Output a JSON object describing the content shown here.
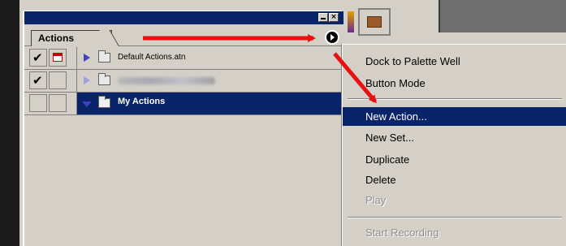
{
  "palette": {
    "tab_label": "Actions",
    "menu_button_icon": "play-triangle-icon",
    "sets": [
      {
        "name": "Default Actions.atn",
        "checked": true,
        "dialog": true,
        "expanded": false,
        "selected": false
      },
      {
        "name": "",
        "checked": true,
        "dialog": false,
        "expanded": false,
        "selected": false
      },
      {
        "name": "My Actions",
        "checked": false,
        "dialog": false,
        "expanded": true,
        "selected": true
      }
    ]
  },
  "flyout_menu": {
    "items": [
      {
        "label": "Dock to Palette Well"
      },
      {
        "label": "Button Mode"
      },
      {
        "label": "New Action..."
      },
      {
        "label": "New Set..."
      },
      {
        "label": "Duplicate"
      },
      {
        "label": "Delete"
      },
      {
        "label": "Play"
      },
      {
        "label": "Start Recording"
      }
    ],
    "highlighted": "New Action...",
    "disabled": [
      "Play",
      "Start Recording"
    ]
  },
  "annotation": {
    "arrow_color": "#e81010"
  },
  "colors": {
    "selection": "#0a246a",
    "face": "#d4d0c8"
  }
}
